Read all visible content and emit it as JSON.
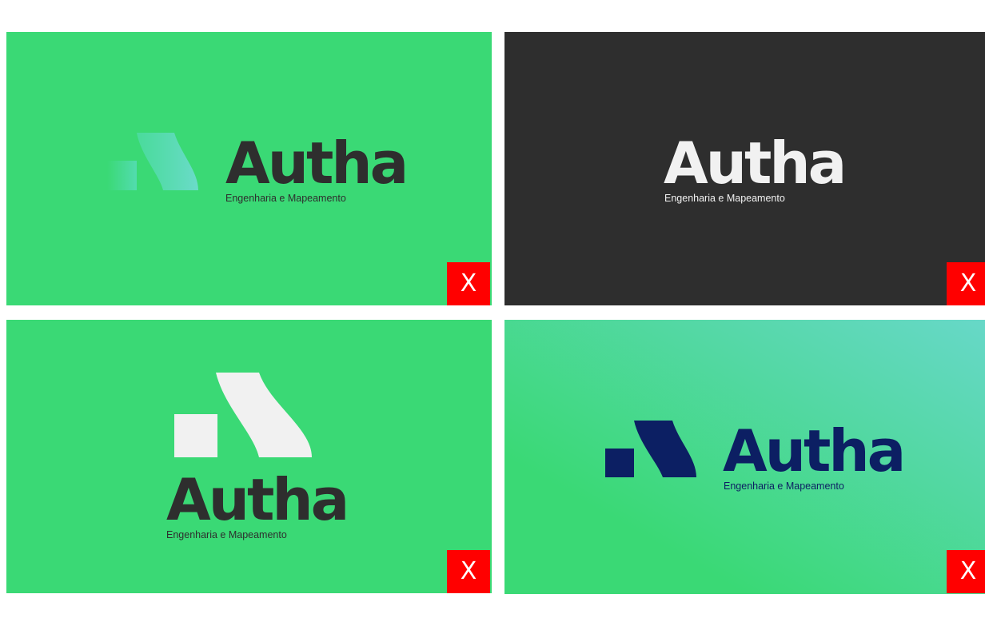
{
  "colors": {
    "green": "#3ad975",
    "charcoal": "#2e2e2e",
    "light": "#f1f1f1",
    "navy": "#0c1f63",
    "teal": "#67d8c8",
    "mint_gradient_start": "#55dcb5",
    "mint_gradient_end": "#6bdbc9",
    "badge_red": "#ff0000",
    "badge_text": "#ffffff"
  },
  "panels": [
    {
      "wordmark": "Autha",
      "tagline": "Engenharia e Mapeamento",
      "badge": "X",
      "background": "green",
      "mark": "gradient-faded-symbol"
    },
    {
      "wordmark": "Autha",
      "tagline": "Engenharia e Mapeamento",
      "badge": "X",
      "background": "charcoal",
      "mark": "none"
    },
    {
      "wordmark": "Autha",
      "tagline": "Engenharia e Mapeamento",
      "badge": "X",
      "background": "green",
      "mark": "light-symbol"
    },
    {
      "wordmark": "Autha",
      "tagline": "Engenharia e Mapeamento",
      "badge": "X",
      "background": "green-to-teal-gradient",
      "mark": "navy-symbol"
    }
  ]
}
